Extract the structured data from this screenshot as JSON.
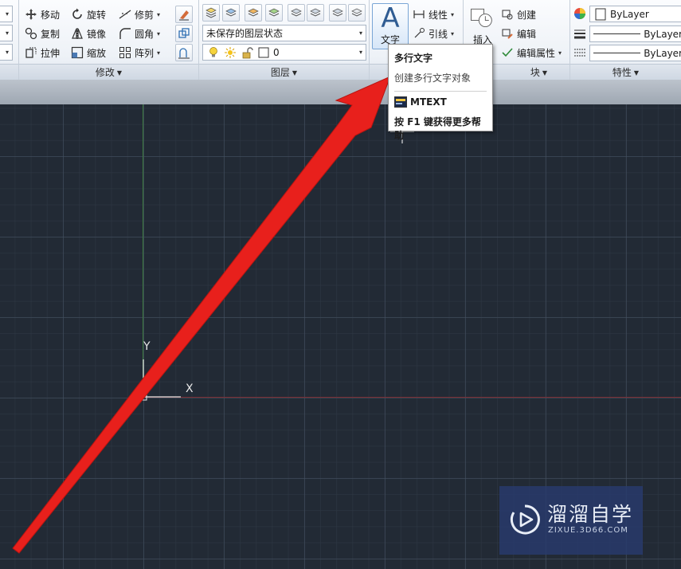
{
  "ribbon": {
    "modify": {
      "title": "修改",
      "tools": {
        "move": "移动",
        "rotate": "旋转",
        "trim": "修剪",
        "copy": "复制",
        "mirror": "镜像",
        "fillet": "圆角",
        "stretch": "拉伸",
        "scale": "缩放",
        "array": "阵列"
      }
    },
    "layers": {
      "title": "图层",
      "layer_state": "未保存的图层状态",
      "current_layer": "0"
    },
    "annotation": {
      "text_label": "文字",
      "text_glyph": "A",
      "dimension": "线性",
      "leader": "引线"
    },
    "block": {
      "title": "块",
      "insert": "插入",
      "create": "创建",
      "edit": "编辑",
      "edit_attributes": "编辑属性"
    },
    "properties": {
      "title": "特性",
      "color": "ByLayer",
      "linetype": "ByLayer",
      "lineweight": "ByLayer"
    }
  },
  "tooltip": {
    "title": "多行文字",
    "description": "创建多行文字对象",
    "command": "MTEXT",
    "help": "按 F1 键获得更多帮助"
  },
  "ucs": {
    "x_label": "X",
    "y_label": "Y"
  },
  "colors": {
    "canvas_bg": "#222a35",
    "arrow": "#e8201c",
    "y_axis": "#3d7a3f",
    "x_axis": "#7b2d33"
  },
  "watermark": {
    "name": "溜溜自学",
    "url": "ZIXUE.3D66.COM"
  }
}
